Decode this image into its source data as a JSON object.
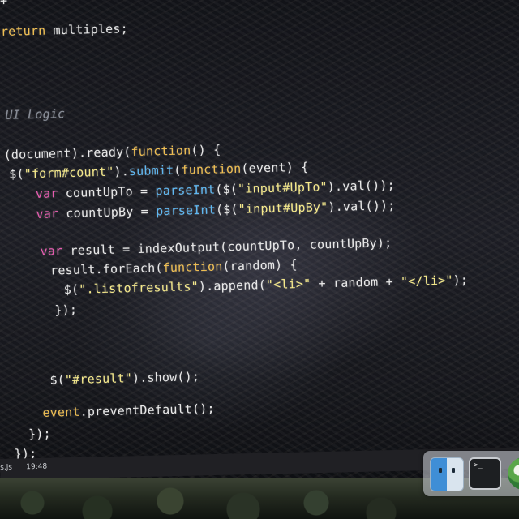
{
  "editor": {
    "lines": [
      [
        {
          "c": "kw",
          "t": "return"
        },
        {
          "c": "pl",
          "t": " multiples;"
        }
      ],
      [
        {
          "c": "cm",
          "t": "UI Logic"
        }
      ],
      [
        {
          "c": "pl",
          "t": "(document).ready("
        },
        {
          "c": "kw",
          "t": "function"
        },
        {
          "c": "pl",
          "t": "() {"
        }
      ],
      [
        {
          "c": "pl",
          "t": "$("
        },
        {
          "c": "str",
          "t": "\"form#count\""
        },
        {
          "c": "pl",
          "t": ")."
        },
        {
          "c": "fn",
          "t": "submit"
        },
        {
          "c": "pl",
          "t": "("
        },
        {
          "c": "kw",
          "t": "function"
        },
        {
          "c": "pl",
          "t": "(event) {"
        }
      ],
      [
        {
          "c": "kw2",
          "t": "var"
        },
        {
          "c": "pl",
          "t": " countUpTo = "
        },
        {
          "c": "fn",
          "t": "parseInt"
        },
        {
          "c": "pl",
          "t": "($("
        },
        {
          "c": "str",
          "t": "\"input#UpTo\""
        },
        {
          "c": "pl",
          "t": ").val());"
        }
      ],
      [
        {
          "c": "kw2",
          "t": "var"
        },
        {
          "c": "pl",
          "t": " countUpBy = "
        },
        {
          "c": "fn",
          "t": "parseInt"
        },
        {
          "c": "pl",
          "t": "($("
        },
        {
          "c": "str",
          "t": "\"input#UpBy\""
        },
        {
          "c": "pl",
          "t": ").val());"
        }
      ],
      [
        {
          "c": "kw2",
          "t": "var"
        },
        {
          "c": "pl",
          "t": " result = indexOutput(countUpTo, countUpBy);"
        }
      ],
      [
        {
          "c": "pl",
          "t": "result.forEach("
        },
        {
          "c": "kw",
          "t": "function"
        },
        {
          "c": "pl",
          "t": "(random) {"
        }
      ],
      [
        {
          "c": "pl",
          "t": "$("
        },
        {
          "c": "str",
          "t": "\".listofresults\""
        },
        {
          "c": "pl",
          "t": ").append("
        },
        {
          "c": "str",
          "t": "\"<li>\""
        },
        {
          "c": "pl",
          "t": " + random + "
        },
        {
          "c": "str",
          "t": "\"</li>\""
        },
        {
          "c": "pl",
          "t": ");"
        }
      ],
      [
        {
          "c": "pl",
          "t": "});"
        }
      ],
      [
        {
          "c": "pl",
          "t": "$("
        },
        {
          "c": "str",
          "t": "\"#result\""
        },
        {
          "c": "pl",
          "t": ").show();"
        }
      ],
      [
        {
          "c": "kw",
          "t": "event"
        },
        {
          "c": "pl",
          "t": ".preventDefault();"
        }
      ],
      [
        {
          "c": "pl",
          "t": "});"
        }
      ],
      [
        {
          "c": "pl",
          "t": "});"
        }
      ]
    ],
    "fragments": {
      "brace": "+"
    }
  },
  "status_bar": {
    "filename": "s.js",
    "time": "19:48"
  },
  "dock": {
    "items": [
      "finder-icon",
      "terminal-icon",
      "maps-icon"
    ],
    "terminal_prompt": ">_"
  },
  "colors": {
    "keyword": "#f0bf52",
    "var_keyword": "#e85ab0",
    "function_name": "#5fb8f2",
    "string": "#f5e98a",
    "comment": "#8a8f99"
  }
}
